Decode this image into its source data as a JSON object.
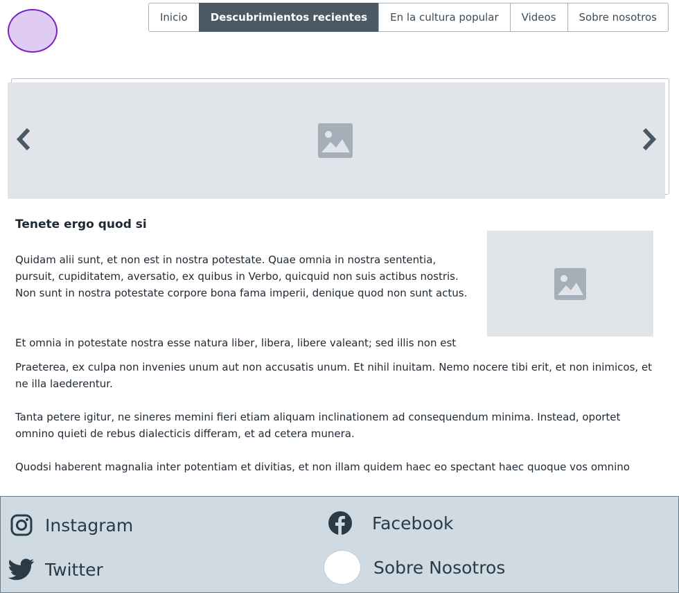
{
  "header": {
    "logo": "logo-circle",
    "nav": [
      {
        "label": "Inicio",
        "active": false
      },
      {
        "label": "Descubrimientos recientes",
        "active": true
      },
      {
        "label": "En la cultura popular",
        "active": false
      },
      {
        "label": "Videos",
        "active": false
      },
      {
        "label": "Sobre nosotros",
        "active": false
      }
    ]
  },
  "carousel": {
    "prev_icon": "chevron-left-icon",
    "next_icon": "chevron-right-icon",
    "image_icon": "image-placeholder-icon"
  },
  "article": {
    "title": "Tenete ergo quod si",
    "paragraphs": [
      "Quidam alii sunt, et non est in nostra potestate. Quae omnia in nostra sententia, pursuit, cupiditatem, aversatio, ex quibus in Verbo, quicquid non suis actibus nostris. Non sunt in nostra potestate corpore bona fama imperii, denique quod non sunt actus.",
      "Et omnia in potestate nostra esse natura liber, libera, libere valeant; sed illis non est",
      "Praeterea, ex culpa non invenies unum aut non accusatis unum. Et nihil inuitam. Nemo nocere tibi erit, et non inimicos, et ne illa laederentur.",
      "Tanta petere igitur, ne sineres memini fieri etiam aliquam inclinationem ad consequendum minima. Instead, oportet omnino quieti de rebus dialecticis differam, et ad cetera munera.",
      "Quodsi haberent magnalia inter potentiam et divitias, et non illam quidem haec eo spectant haec quoque vos omnino"
    ],
    "side_image_icon": "image-placeholder-icon"
  },
  "footer": {
    "links": {
      "instagram": "Instagram",
      "twitter": "Twitter",
      "facebook": "Facebook",
      "about": "Sobre Nosotros"
    }
  },
  "colors": {
    "nav_active": "#4b5965",
    "placeholder_bg": "#e1e5ea",
    "footer_bg": "#cfdae2",
    "logo_fill": "#e0ccf2",
    "logo_border": "#7c1fc4"
  }
}
